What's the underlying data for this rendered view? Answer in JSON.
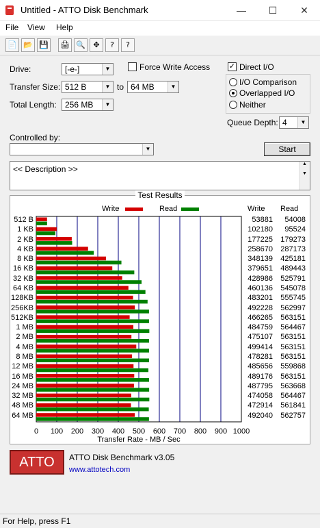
{
  "window": {
    "title": "Untitled - ATTO Disk Benchmark",
    "min": "—",
    "max": "☐",
    "close": "✕"
  },
  "menu": [
    "File",
    "View",
    "Help"
  ],
  "toolbar": [
    "📄",
    "📂",
    "💾",
    "🖨",
    "🔍",
    "✥",
    "?",
    "?"
  ],
  "form": {
    "drive_label": "Drive:",
    "drive_value": "[-e-]",
    "transfer_label": "Transfer Size:",
    "transfer_from": "512 B",
    "to_label": "to",
    "transfer_to": "64 MB",
    "total_label": "Total Length:",
    "total_value": "256 MB",
    "force_write_label": "Force Write Access",
    "force_write_checked": false,
    "direct_io_label": "Direct I/O",
    "direct_io_checked": true,
    "io_comparison": "I/O Comparison",
    "overlapped_io": "Overlapped I/O",
    "neither": "Neither",
    "queue_label": "Queue Depth:",
    "queue_value": "4",
    "controlled_label": "Controlled by:",
    "controlled_value": "",
    "start_label": "Start",
    "description": "<< Description >>"
  },
  "results": {
    "title": "Test Results",
    "write_legend": "Write",
    "read_legend": "Read",
    "write_header": "Write",
    "read_header": "Read",
    "write_color": "#d40000",
    "read_color": "#008000",
    "axis_title": "Transfer Rate - MB / Sec"
  },
  "chart_data": {
    "type": "bar",
    "title": "Test Results",
    "xlabel": "Transfer Rate - MB / Sec",
    "xlim": [
      0,
      1000
    ],
    "ticks": [
      0,
      100,
      200,
      300,
      400,
      500,
      600,
      700,
      800,
      900,
      1000
    ],
    "categories": [
      "512 B",
      "1 KB",
      "2 KB",
      "4 KB",
      "8 KB",
      "16 KB",
      "32 KB",
      "64 KB",
      "128KB",
      "256KB",
      "512KB",
      "1 MB",
      "2 MB",
      "4 MB",
      "8 MB",
      "12 MB",
      "16 MB",
      "24 MB",
      "32 MB",
      "48 MB",
      "64 MB"
    ],
    "series": [
      {
        "name": "Write",
        "values": [
          53881,
          102180,
          177225,
          258670,
          348139,
          379651,
          428986,
          460136,
          483201,
          492228,
          466265,
          484759,
          475107,
          499414,
          478281,
          485656,
          489176,
          487795,
          474058,
          472914,
          492040
        ]
      },
      {
        "name": "Read",
        "values": [
          54008,
          95524,
          179273,
          287173,
          425181,
          489443,
          525791,
          545078,
          555745,
          562997,
          563151,
          564467,
          563151,
          563151,
          563151,
          559868,
          563151,
          563668,
          564467,
          561841,
          562757
        ]
      }
    ]
  },
  "footer": {
    "logo": "ATTO",
    "product": "ATTO Disk Benchmark v3.05",
    "url": "www.attotech.com"
  },
  "status": "For Help, press F1"
}
